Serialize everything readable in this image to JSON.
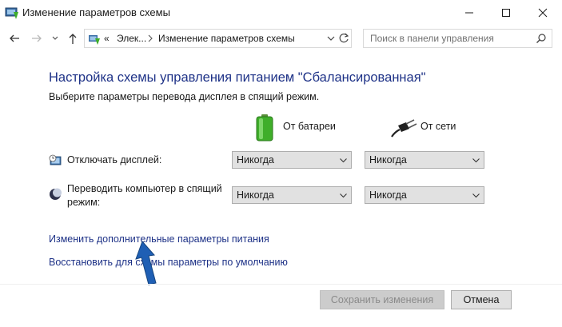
{
  "window": {
    "title": "Изменение параметров схемы"
  },
  "address": {
    "overflow": "«",
    "crumbs": [
      "Элек...",
      "Изменение параметров схемы"
    ],
    "search_placeholder": "Поиск в панели управления"
  },
  "content": {
    "title": "Настройка схемы управления питанием \"Сбалансированная\"",
    "subtitle": "Выберите параметры перевода дисплея в спящий режим.",
    "columns": {
      "battery": "От батареи",
      "ac": "От сети"
    },
    "rows": [
      {
        "label": "Отключать дисплей:",
        "battery_value": "Никогда",
        "ac_value": "Никогда",
        "icon": "display-clock-icon"
      },
      {
        "label": "Переводить компьютер в спящий режим:",
        "battery_value": "Никогда",
        "ac_value": "Никогда",
        "icon": "sleep-moon-icon"
      }
    ],
    "links": {
      "advanced": "Изменить дополнительные параметры питания",
      "restore": "Восстановить для схемы параметры по умолчанию"
    }
  },
  "footer": {
    "save_label": "Сохранить изменения",
    "cancel_label": "Отмена"
  },
  "colors": {
    "title_blue": "#1e3287",
    "arrow_blue": "#1f5fb4",
    "battery_green": "#3fae2a"
  }
}
